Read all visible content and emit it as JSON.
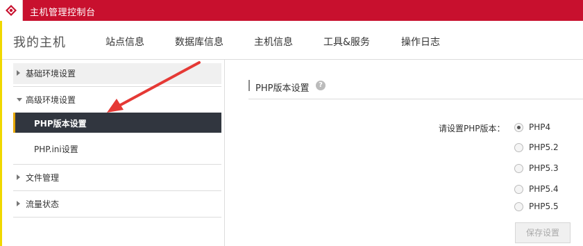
{
  "app": {
    "title": "主机管理控制台",
    "brand_color": "#c8102e",
    "logo_icon": "shield-logo-icon"
  },
  "nav": {
    "brand": "我的主机",
    "items": [
      {
        "label": "站点信息"
      },
      {
        "label": "数据库信息"
      },
      {
        "label": "主机信息"
      },
      {
        "label": "工具&服务"
      },
      {
        "label": "操作日志"
      }
    ]
  },
  "sidebar": {
    "groups": [
      {
        "label": "基础环境设置",
        "expanded": false
      },
      {
        "label": "高级环境设置",
        "expanded": true,
        "items": [
          {
            "label": "PHP版本设置",
            "active": true
          },
          {
            "label": "PHP.ini设置",
            "active": false
          }
        ]
      },
      {
        "label": "文件管理",
        "expanded": false
      },
      {
        "label": "流量状态",
        "expanded": false
      }
    ],
    "active_color": "#31363f",
    "active_accent": "#e6a700"
  },
  "content": {
    "section_title": "PHP版本设置",
    "help_icon": "?",
    "form_label": "请设置PHP版本：",
    "options": [
      {
        "label": "PHP4",
        "checked": true
      },
      {
        "label": "PHP5.2",
        "checked": false
      },
      {
        "label": "PHP5.3",
        "checked": false
      },
      {
        "label": "PHP5.4",
        "checked": false
      },
      {
        "label": "PHP5.5",
        "checked": false
      }
    ],
    "save_label": "保存设置"
  },
  "annotation": {
    "arrow_color": "#e53935"
  }
}
